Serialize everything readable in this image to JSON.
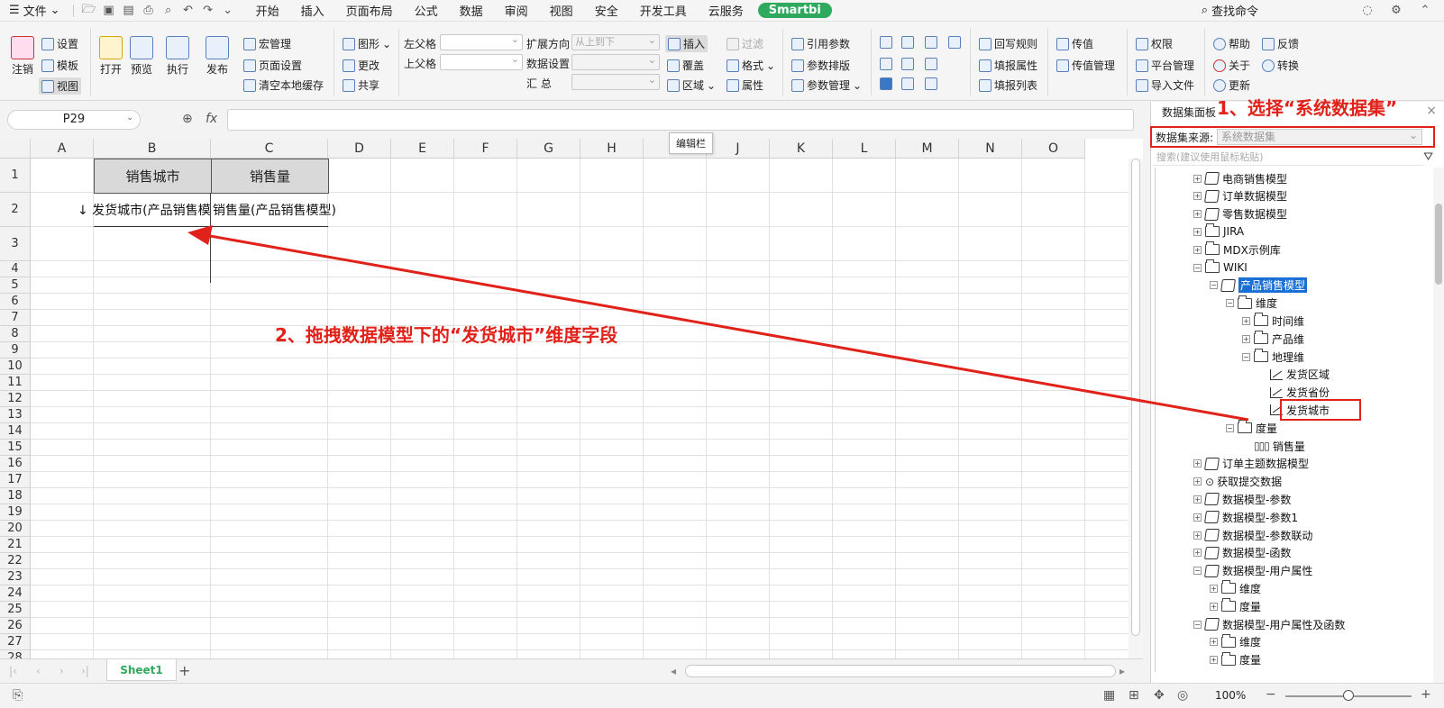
{
  "menubar": {
    "file_label": "文件",
    "tabs": [
      "开始",
      "插入",
      "页面布局",
      "公式",
      "数据",
      "审阅",
      "视图",
      "安全",
      "开发工具",
      "云服务"
    ],
    "smartbi_label": "Smartbi",
    "search_label": "查找命令"
  },
  "ribbon": {
    "logout": "注销",
    "settings": "设置",
    "template": "模板",
    "view": "视图",
    "open": "打开",
    "preview": "预览",
    "execute": "执行",
    "publish": "发布",
    "macro": "宏管理",
    "page_setup": "页面设置",
    "clear_cache": "清空本地缓存",
    "chart": "图形",
    "change": "更改",
    "share": "共享",
    "left_parent": "左父格",
    "top_parent": "上父格",
    "expand_dir": "扩展方向",
    "expand_value": "从上到下",
    "data_settings": "数据设置",
    "summary": "汇    总",
    "insert": "插入",
    "cover": "覆盖",
    "region": "区域",
    "filter": "过滤",
    "format": "格式",
    "property": "属性",
    "ref_param": "引用参数",
    "param_layout": "参数排版",
    "param_manage": "参数管理",
    "writeback": "回写规则",
    "fill_attr": "填报属性",
    "fill_list": "填报列表",
    "pass_value": "传值",
    "pass_value_manage": "传值管理",
    "permission": "权限",
    "platform": "平台管理",
    "import_file": "导入文件",
    "help": "帮助",
    "about": "关于",
    "update": "更新",
    "feedback": "反馈",
    "convert": "转换"
  },
  "formula": {
    "namebox": "P29",
    "fx": "fx",
    "tooltip": "编辑栏"
  },
  "grid": {
    "columns": [
      "A",
      "B",
      "C",
      "D",
      "E",
      "F",
      "G",
      "H",
      "I",
      "J",
      "K",
      "L",
      "M",
      "N",
      "O"
    ],
    "rows": [
      "1",
      "2",
      "3",
      "4",
      "5",
      "6",
      "7",
      "8",
      "9",
      "10",
      "11",
      "12",
      "13",
      "14",
      "15",
      "16",
      "17",
      "18",
      "19",
      "20",
      "21",
      "22",
      "23",
      "24",
      "25",
      "26",
      "27",
      "28"
    ],
    "header_b1": "销售城市",
    "header_c1": "销售量",
    "cell_b2": "↓ 发货城市(产品销售模",
    "cell_c2": "销售量(产品销售模型)"
  },
  "annotations": {
    "step1": "1、选择“系统数据集”",
    "step2": "2、拖拽数据模型下的“发货城市”维度字段",
    "arrow_color": "#e0221a"
  },
  "panel": {
    "title": "数据集面板",
    "source_label": "数据集来源:",
    "source_value": "系统数据集",
    "search_placeholder": "搜索(建议使用鼠标粘贴)",
    "tree": [
      {
        "label": "电商销售模型",
        "level": 0,
        "icon": "cube-icon",
        "exp": "+"
      },
      {
        "label": "订单数据模型",
        "level": 0,
        "icon": "cube-icon",
        "exp": "+"
      },
      {
        "label": "零售数据模型",
        "level": 0,
        "icon": "cube-icon",
        "exp": "+"
      },
      {
        "label": "JIRA",
        "level": 0,
        "icon": "folder-icon",
        "exp": "+"
      },
      {
        "label": "MDX示例库",
        "level": 0,
        "icon": "folder-icon",
        "exp": "+"
      },
      {
        "label": "WIKI",
        "level": 0,
        "icon": "folder-icon",
        "exp": "-"
      },
      {
        "label": "产品销售模型",
        "level": 1,
        "icon": "cube-icon",
        "exp": "-",
        "selected": true
      },
      {
        "label": "维度",
        "level": 2,
        "icon": "folder-icon",
        "exp": "-"
      },
      {
        "label": "时间维",
        "level": 3,
        "icon": "folder-icon",
        "exp": "+"
      },
      {
        "label": "产品维",
        "level": 3,
        "icon": "folder-icon",
        "exp": "+"
      },
      {
        "label": "地理维",
        "level": 3,
        "icon": "folder-icon",
        "exp": "-"
      },
      {
        "label": "发货区域",
        "level": 4,
        "icon": "level-icon",
        "exp": ""
      },
      {
        "label": "发货省份",
        "level": 4,
        "icon": "level-icon",
        "exp": ""
      },
      {
        "label": "发货城市",
        "level": 4,
        "icon": "level-icon",
        "exp": "",
        "highlight": true
      },
      {
        "label": "度量",
        "level": 2,
        "icon": "folder-icon",
        "exp": "-"
      },
      {
        "label": "销售量",
        "level": 3,
        "icon": "measure-icon",
        "exp": ""
      },
      {
        "label": "订单主题数据模型",
        "level": 0,
        "icon": "cube-icon",
        "exp": "+"
      },
      {
        "label": "获取提交数据",
        "level": 0,
        "icon": "query-icon",
        "exp": "+"
      },
      {
        "label": "数据模型-参数",
        "level": 0,
        "icon": "cube-icon",
        "exp": "+"
      },
      {
        "label": "数据模型-参数1",
        "level": 0,
        "icon": "cube-icon",
        "exp": "+"
      },
      {
        "label": "数据模型-参数联动",
        "level": 0,
        "icon": "cube-icon",
        "exp": "+"
      },
      {
        "label": "数据模型-函数",
        "level": 0,
        "icon": "cube-icon",
        "exp": "+"
      },
      {
        "label": "数据模型-用户属性",
        "level": 0,
        "icon": "cube-icon",
        "exp": "-"
      },
      {
        "label": "维度",
        "level": 1,
        "icon": "folder-icon",
        "exp": "+"
      },
      {
        "label": "度量",
        "level": 1,
        "icon": "folder-icon",
        "exp": "+"
      },
      {
        "label": "数据模型-用户属性及函数",
        "level": 0,
        "icon": "cube-icon",
        "exp": "-"
      },
      {
        "label": "维度",
        "level": 1,
        "icon": "folder-icon",
        "exp": "+"
      },
      {
        "label": "度量",
        "level": 1,
        "icon": "folder-icon",
        "exp": "+"
      }
    ]
  },
  "sheetbar": {
    "sheet_name": "Sheet1"
  },
  "statusbar": {
    "zoom": "100%"
  }
}
